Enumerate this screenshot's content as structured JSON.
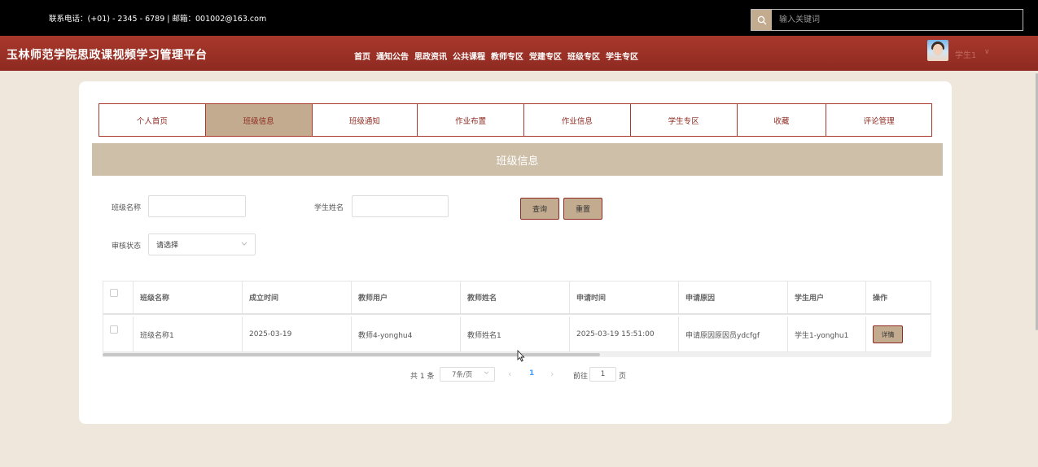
{
  "topbar": {
    "contact": "联系电话：(+01) - 2345 - 6789 | 邮箱：001002@163.com",
    "search_placeholder": "输入关键词"
  },
  "header": {
    "site_title": "玉林师范学院思政课视频学习管理平台",
    "nav": [
      "首页",
      "通知公告",
      "思政资讯",
      "公共课程",
      "教师专区",
      "党建专区",
      "班级专区",
      "学生专区"
    ],
    "user_name": "学生1",
    "user_caret": "∨"
  },
  "tabs": [
    {
      "label": "个人首页",
      "active": false
    },
    {
      "label": "班级信息",
      "active": true
    },
    {
      "label": "班级通知",
      "active": false
    },
    {
      "label": "作业布置",
      "active": false
    },
    {
      "label": "作业信息",
      "active": false
    },
    {
      "label": "学生专区",
      "active": false
    },
    {
      "label": "收藏",
      "active": false
    },
    {
      "label": "评论管理",
      "active": false
    }
  ],
  "section_title": "班级信息",
  "filters": {
    "class_name_label": "班级名称",
    "class_name_value": "",
    "student_name_label": "学生姓名",
    "student_name_value": "",
    "status_label": "审核状态",
    "status_value": "请选择",
    "query_button": "查询",
    "reset_button": "重置"
  },
  "table": {
    "columns": [
      "班级名称",
      "成立时间",
      "教师用户",
      "教师姓名",
      "申请时间",
      "申请原因",
      "学生用户",
      "操作"
    ],
    "rows": [
      [
        "班级名称1",
        "2025-03-19",
        "教师4-yonghu4",
        "教师姓名1",
        "2025-03-19 15:51:00",
        "申请原因原因员ydcfgf",
        "学生1-yonghu1",
        "详情"
      ]
    ]
  },
  "pagination": {
    "total": "共 1 条",
    "page_size": "7条/页",
    "prev": "‹",
    "current_page": "1",
    "next": "›",
    "goto_label": "前往",
    "goto_value": "1",
    "page_suffix": "页"
  },
  "colors": {
    "topbar": "#000000",
    "navbar": "#a8382c",
    "accent": "#c2ab8f",
    "section_header": "#cdbfa8",
    "page_bg": "#efe6dc"
  }
}
